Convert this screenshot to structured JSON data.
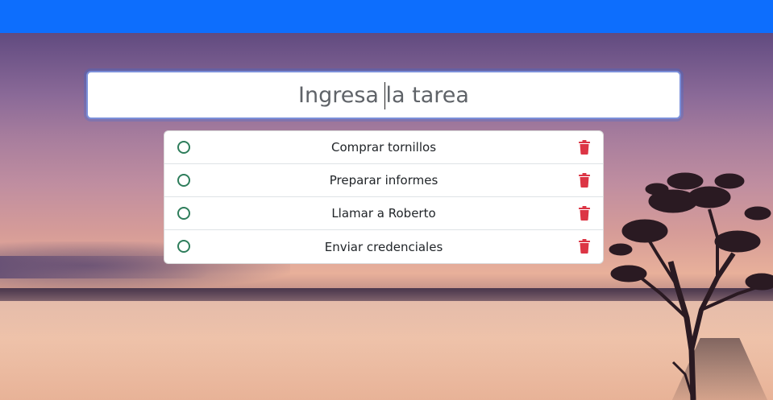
{
  "header": {
    "bar_color": "#0d6efd"
  },
  "task_input": {
    "placeholder": "Ingresa la tarea",
    "value": ""
  },
  "tasks": [
    {
      "label": "Comprar tornillos",
      "done": false
    },
    {
      "label": "Preparar informes",
      "done": false
    },
    {
      "label": "Llamar a Roberto",
      "done": false
    },
    {
      "label": "Enviar credenciales",
      "done": false
    }
  ],
  "icons": {
    "check": "circle-outline-icon",
    "delete": "trash-icon"
  },
  "colors": {
    "check": "#2e7d5b",
    "delete": "#dc3545"
  }
}
